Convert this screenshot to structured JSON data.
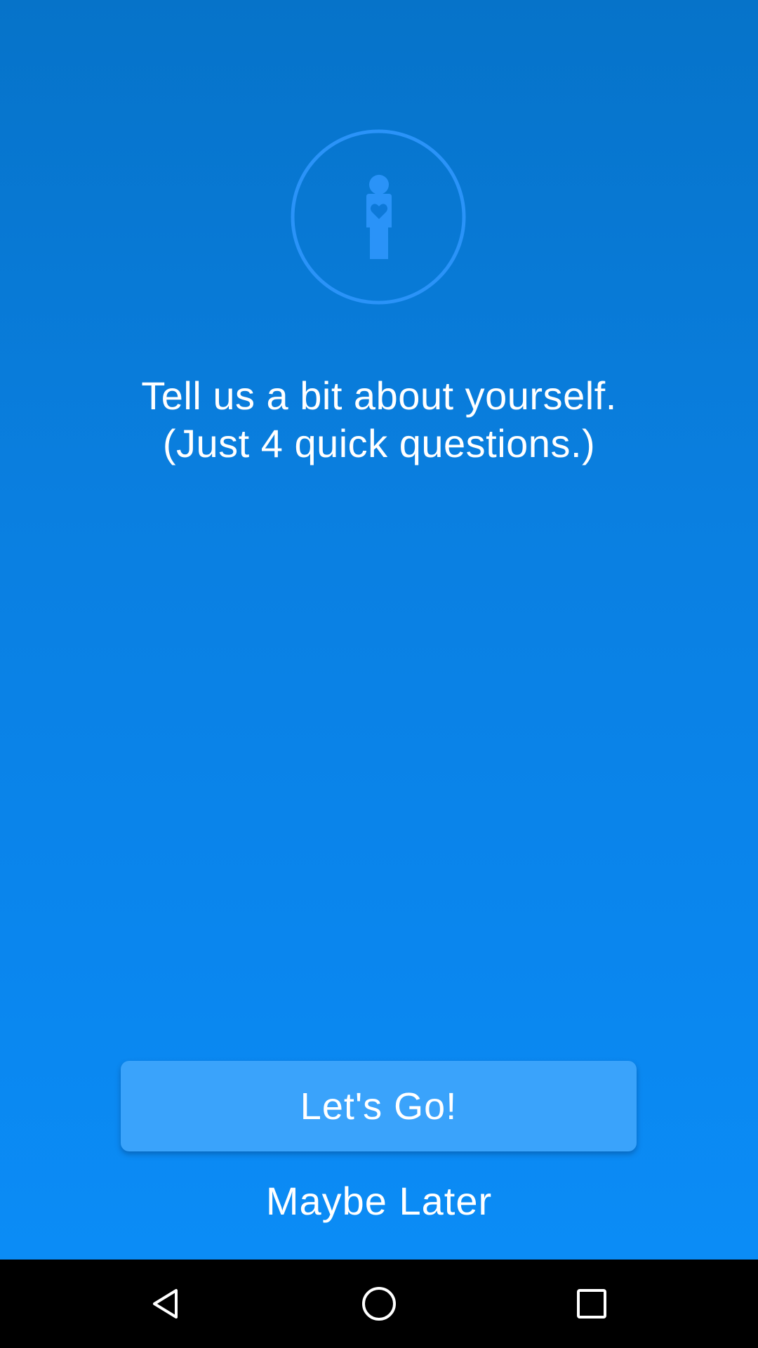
{
  "onboarding": {
    "icon": "person-heart-icon",
    "prompt_line1": "Tell us a bit about yourself.",
    "prompt_line2": "(Just 4 quick questions.)",
    "primary_button_label": "Let's Go!",
    "secondary_button_label": "Maybe Later"
  },
  "navbar": {
    "back_icon": "back-triangle-icon",
    "home_icon": "home-circle-icon",
    "recent_icon": "recent-apps-square-icon"
  },
  "colors": {
    "background_top": "#0673c9",
    "background_bottom": "#0b8cf6",
    "icon_accent": "#2a93f8",
    "button_fill": "#3aa3fb",
    "text": "#ffffff",
    "navbar": "#000000"
  }
}
